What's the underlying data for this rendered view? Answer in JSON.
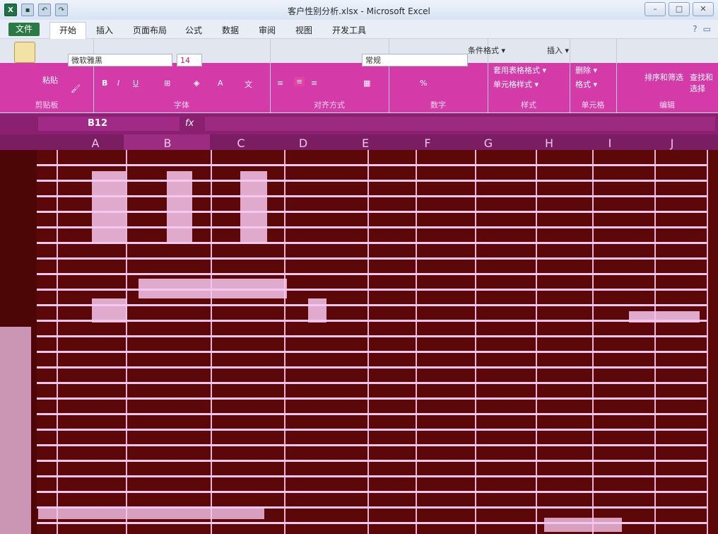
{
  "window": {
    "title": "客户性别分析.xlsx - Microsoft Excel",
    "controls": [
      "–",
      "□",
      "✕"
    ]
  },
  "tabs": {
    "file": "文件",
    "items": [
      "开始",
      "插入",
      "页面布局",
      "公式",
      "数据",
      "审阅",
      "视图",
      "开发工具"
    ]
  },
  "ribbon": {
    "font_name": "微软雅黑",
    "font_size": "14",
    "number_format": "常规",
    "groups": [
      "剪贴板",
      "字体",
      "对齐方式",
      "数字",
      "样式",
      "单元格",
      "编辑"
    ],
    "clipboard_paste": "粘贴",
    "styles": [
      "条件格式 ▾",
      "套用表格格式 ▾",
      "单元格样式 ▾"
    ],
    "cells": [
      "插入 ▾",
      "删除 ▾",
      "格式 ▾"
    ],
    "editing": [
      "排序和筛选",
      "查找和选择"
    ],
    "font_buttons": [
      "B",
      "I",
      "U"
    ],
    "percent": "%"
  },
  "formula_bar": {
    "name_box": "B12",
    "fx_label": "fx"
  },
  "columns": [
    "A",
    "B",
    "C",
    "D",
    "E",
    "F",
    "G",
    "H",
    "I",
    "J"
  ]
}
